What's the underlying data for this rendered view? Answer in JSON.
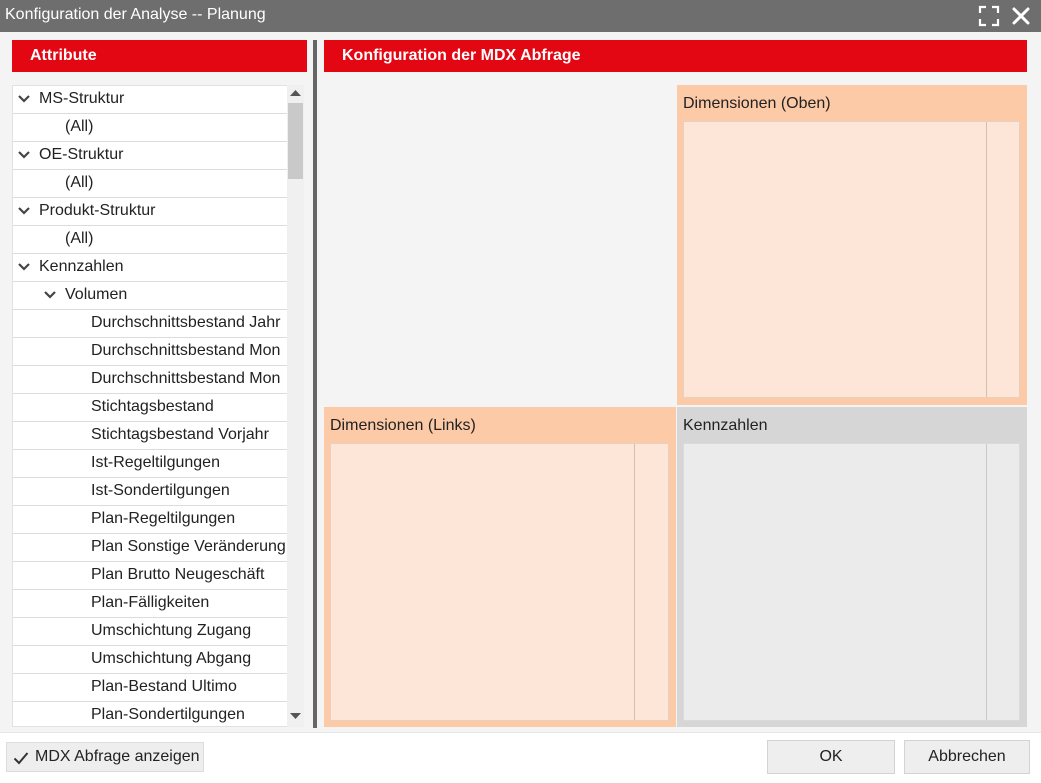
{
  "window": {
    "title": "Konfiguration der Analyse -- Planung"
  },
  "attributes": {
    "header": "Attribute",
    "tree": [
      {
        "label": "MS-Struktur",
        "level": 0,
        "expanded": true
      },
      {
        "label": "(All)",
        "level": 1,
        "expanded": null
      },
      {
        "label": "OE-Struktur",
        "level": 0,
        "expanded": true
      },
      {
        "label": "(All)",
        "level": 1,
        "expanded": null
      },
      {
        "label": "Produkt-Struktur",
        "level": 0,
        "expanded": true
      },
      {
        "label": "(All)",
        "level": 1,
        "expanded": null
      },
      {
        "label": "Kennzahlen",
        "level": 0,
        "expanded": true
      },
      {
        "label": "Volumen",
        "level": 1,
        "expanded": true
      },
      {
        "label": "Durchschnittsbestand Jahr",
        "level": 2,
        "expanded": null
      },
      {
        "label": "Durchschnittsbestand Mon",
        "level": 2,
        "expanded": null
      },
      {
        "label": "Durchschnittsbestand Mon",
        "level": 2,
        "expanded": null
      },
      {
        "label": "Stichtagsbestand",
        "level": 2,
        "expanded": null
      },
      {
        "label": "Stichtagsbestand Vorjahr",
        "level": 2,
        "expanded": null
      },
      {
        "label": "Ist-Regeltilgungen",
        "level": 2,
        "expanded": null
      },
      {
        "label": "Ist-Sondertilgungen",
        "level": 2,
        "expanded": null
      },
      {
        "label": "Plan-Regeltilgungen",
        "level": 2,
        "expanded": null
      },
      {
        "label": "Plan Sonstige Veränderung",
        "level": 2,
        "expanded": null
      },
      {
        "label": "Plan Brutto Neugeschäft",
        "level": 2,
        "expanded": null
      },
      {
        "label": "Plan-Fälligkeiten",
        "level": 2,
        "expanded": null
      },
      {
        "label": "Umschichtung Zugang",
        "level": 2,
        "expanded": null
      },
      {
        "label": "Umschichtung Abgang",
        "level": 2,
        "expanded": null
      },
      {
        "label": "Plan-Bestand Ultimo",
        "level": 2,
        "expanded": null
      },
      {
        "label": "Plan-Sondertilgungen",
        "level": 2,
        "expanded": null
      }
    ]
  },
  "mdx": {
    "header": "Konfiguration der MDX Abfrage",
    "dimensions_top": "Dimensionen (Oben)",
    "dimensions_left": "Dimensionen (Links)",
    "measures": "Kennzahlen"
  },
  "footer": {
    "show_mdx_label": "MDX Abfrage anzeigen",
    "show_mdx_checked": true,
    "ok_label": "OK",
    "cancel_label": "Abbrechen"
  },
  "icons": {
    "maximize": "maximize-icon",
    "close": "close-icon",
    "expand": "chevron-down-icon",
    "check": "checkmark-icon"
  },
  "colors": {
    "titlebar": "#6e6e6e",
    "header_red": "#e30613",
    "zone_orange": "#fdcaa8",
    "zone_orange_inner": "#fde6d8",
    "zone_grey": "#d6d6d6",
    "zone_grey_inner": "#ebebeb"
  }
}
